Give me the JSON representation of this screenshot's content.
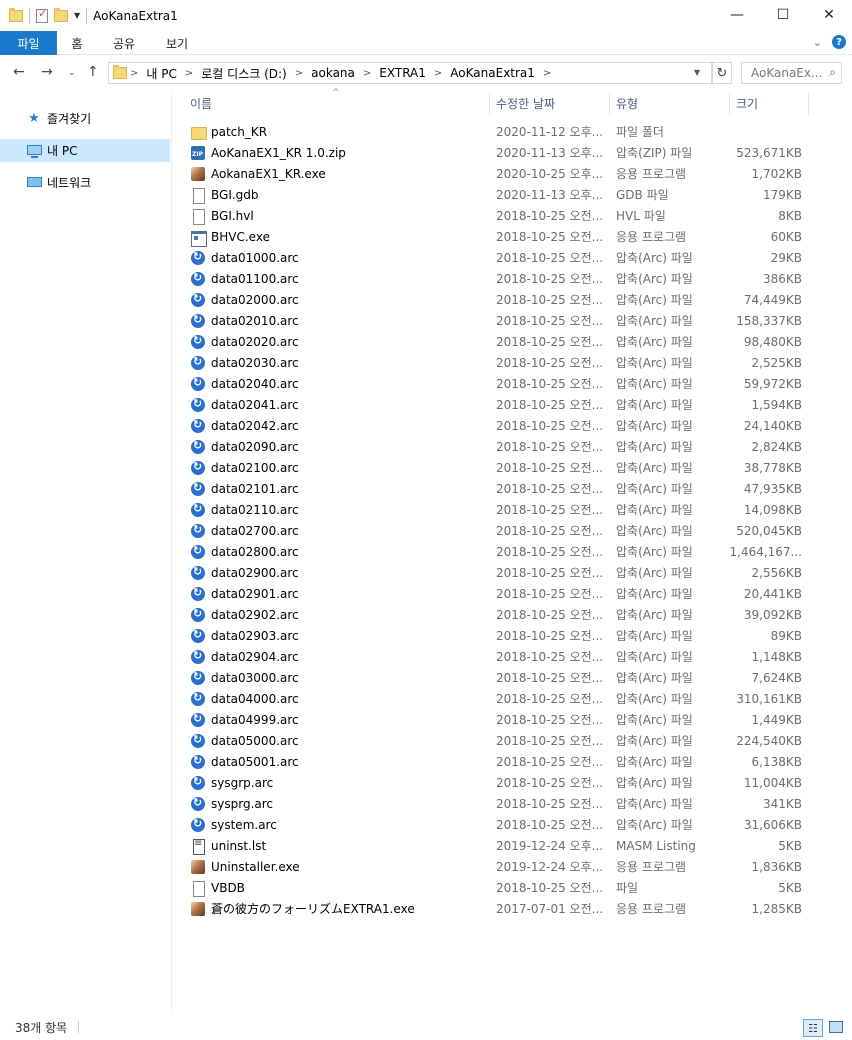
{
  "window": {
    "title": "AoKanaExtra1",
    "minimize": "—",
    "maximize": "☐",
    "close": "✕"
  },
  "ribbon": {
    "tabs": [
      "파일",
      "홈",
      "공유",
      "보기"
    ]
  },
  "address": {
    "crumbs": [
      "내 PC",
      "로컬 디스크 (D:)",
      "aokana",
      "EXTRA1",
      "AoKanaExtra1"
    ],
    "search_placeholder": "AoKanaEx..."
  },
  "nav": {
    "items": [
      {
        "label": "즐겨찾기",
        "icon": "star-icon",
        "selected": false
      },
      {
        "label": "내 PC",
        "icon": "computer-icon",
        "selected": true
      },
      {
        "label": "네트워크",
        "icon": "network-icon",
        "selected": false
      }
    ]
  },
  "columns": {
    "name": "이름",
    "date": "수정한 날짜",
    "type": "유형",
    "size": "크기"
  },
  "files": [
    {
      "name": "patch_KR",
      "date": "2020-11-12 오후...",
      "type": "파일 폴더",
      "size": "",
      "icon": "folder"
    },
    {
      "name": "AoKanaEX1_KR 1.0.zip",
      "date": "2020-11-13 오후...",
      "type": "압축(ZIP) 파일",
      "size": "523,671KB",
      "icon": "zip"
    },
    {
      "name": "AokanaEX1_KR.exe",
      "date": "2020-10-25 오후...",
      "type": "응용 프로그램",
      "size": "1,702KB",
      "icon": "game"
    },
    {
      "name": "BGI.gdb",
      "date": "2020-11-13 오후...",
      "type": "GDB 파일",
      "size": "179KB",
      "icon": "doc"
    },
    {
      "name": "BGI.hvl",
      "date": "2018-10-25 오전...",
      "type": "HVL 파일",
      "size": "8KB",
      "icon": "doc"
    },
    {
      "name": "BHVC.exe",
      "date": "2018-10-25 오전...",
      "type": "응용 프로그램",
      "size": "60KB",
      "icon": "exe"
    },
    {
      "name": "data01000.arc",
      "date": "2018-10-25 오전...",
      "type": "압축(Arc) 파일",
      "size": "29KB",
      "icon": "arc"
    },
    {
      "name": "data01100.arc",
      "date": "2018-10-25 오전...",
      "type": "압축(Arc) 파일",
      "size": "386KB",
      "icon": "arc"
    },
    {
      "name": "data02000.arc",
      "date": "2018-10-25 오전...",
      "type": "압축(Arc) 파일",
      "size": "74,449KB",
      "icon": "arc"
    },
    {
      "name": "data02010.arc",
      "date": "2018-10-25 오전...",
      "type": "압축(Arc) 파일",
      "size": "158,337KB",
      "icon": "arc"
    },
    {
      "name": "data02020.arc",
      "date": "2018-10-25 오전...",
      "type": "압축(Arc) 파일",
      "size": "98,480KB",
      "icon": "arc"
    },
    {
      "name": "data02030.arc",
      "date": "2018-10-25 오전...",
      "type": "압축(Arc) 파일",
      "size": "2,525KB",
      "icon": "arc"
    },
    {
      "name": "data02040.arc",
      "date": "2018-10-25 오전...",
      "type": "압축(Arc) 파일",
      "size": "59,972KB",
      "icon": "arc"
    },
    {
      "name": "data02041.arc",
      "date": "2018-10-25 오전...",
      "type": "압축(Arc) 파일",
      "size": "1,594KB",
      "icon": "arc"
    },
    {
      "name": "data02042.arc",
      "date": "2018-10-25 오전...",
      "type": "압축(Arc) 파일",
      "size": "24,140KB",
      "icon": "arc"
    },
    {
      "name": "data02090.arc",
      "date": "2018-10-25 오전...",
      "type": "압축(Arc) 파일",
      "size": "2,824KB",
      "icon": "arc"
    },
    {
      "name": "data02100.arc",
      "date": "2018-10-25 오전...",
      "type": "압축(Arc) 파일",
      "size": "38,778KB",
      "icon": "arc"
    },
    {
      "name": "data02101.arc",
      "date": "2018-10-25 오전...",
      "type": "압축(Arc) 파일",
      "size": "47,935KB",
      "icon": "arc"
    },
    {
      "name": "data02110.arc",
      "date": "2018-10-25 오전...",
      "type": "압축(Arc) 파일",
      "size": "14,098KB",
      "icon": "arc"
    },
    {
      "name": "data02700.arc",
      "date": "2018-10-25 오전...",
      "type": "압축(Arc) 파일",
      "size": "520,045KB",
      "icon": "arc"
    },
    {
      "name": "data02800.arc",
      "date": "2018-10-25 오전...",
      "type": "압축(Arc) 파일",
      "size": "1,464,167...",
      "icon": "arc"
    },
    {
      "name": "data02900.arc",
      "date": "2018-10-25 오전...",
      "type": "압축(Arc) 파일",
      "size": "2,556KB",
      "icon": "arc"
    },
    {
      "name": "data02901.arc",
      "date": "2018-10-25 오전...",
      "type": "압축(Arc) 파일",
      "size": "20,441KB",
      "icon": "arc"
    },
    {
      "name": "data02902.arc",
      "date": "2018-10-25 오전...",
      "type": "압축(Arc) 파일",
      "size": "39,092KB",
      "icon": "arc"
    },
    {
      "name": "data02903.arc",
      "date": "2018-10-25 오전...",
      "type": "압축(Arc) 파일",
      "size": "89KB",
      "icon": "arc"
    },
    {
      "name": "data02904.arc",
      "date": "2018-10-25 오전...",
      "type": "압축(Arc) 파일",
      "size": "1,148KB",
      "icon": "arc"
    },
    {
      "name": "data03000.arc",
      "date": "2018-10-25 오전...",
      "type": "압축(Arc) 파일",
      "size": "7,624KB",
      "icon": "arc"
    },
    {
      "name": "data04000.arc",
      "date": "2018-10-25 오전...",
      "type": "압축(Arc) 파일",
      "size": "310,161KB",
      "icon": "arc"
    },
    {
      "name": "data04999.arc",
      "date": "2018-10-25 오전...",
      "type": "압축(Arc) 파일",
      "size": "1,449KB",
      "icon": "arc"
    },
    {
      "name": "data05000.arc",
      "date": "2018-10-25 오전...",
      "type": "압축(Arc) 파일",
      "size": "224,540KB",
      "icon": "arc"
    },
    {
      "name": "data05001.arc",
      "date": "2018-10-25 오전...",
      "type": "압축(Arc) 파일",
      "size": "6,138KB",
      "icon": "arc"
    },
    {
      "name": "sysgrp.arc",
      "date": "2018-10-25 오전...",
      "type": "압축(Arc) 파일",
      "size": "11,004KB",
      "icon": "arc"
    },
    {
      "name": "sysprg.arc",
      "date": "2018-10-25 오전...",
      "type": "압축(Arc) 파일",
      "size": "341KB",
      "icon": "arc"
    },
    {
      "name": "system.arc",
      "date": "2018-10-25 오전...",
      "type": "압축(Arc) 파일",
      "size": "31,606KB",
      "icon": "arc"
    },
    {
      "name": "uninst.lst",
      "date": "2019-12-24 오후...",
      "type": "MASM Listing",
      "size": "5KB",
      "icon": "lst"
    },
    {
      "name": "Uninstaller.exe",
      "date": "2019-12-24 오후...",
      "type": "응용 프로그램",
      "size": "1,836KB",
      "icon": "game"
    },
    {
      "name": "VBDB",
      "date": "2018-10-25 오전...",
      "type": "파일",
      "size": "5KB",
      "icon": "doc"
    },
    {
      "name": "蒼の彼方のフォーリズムEXTRA1.exe",
      "date": "2017-07-01 오전...",
      "type": "응용 프로그램",
      "size": "1,285KB",
      "icon": "game"
    }
  ],
  "status": {
    "count": "38개 항목"
  }
}
